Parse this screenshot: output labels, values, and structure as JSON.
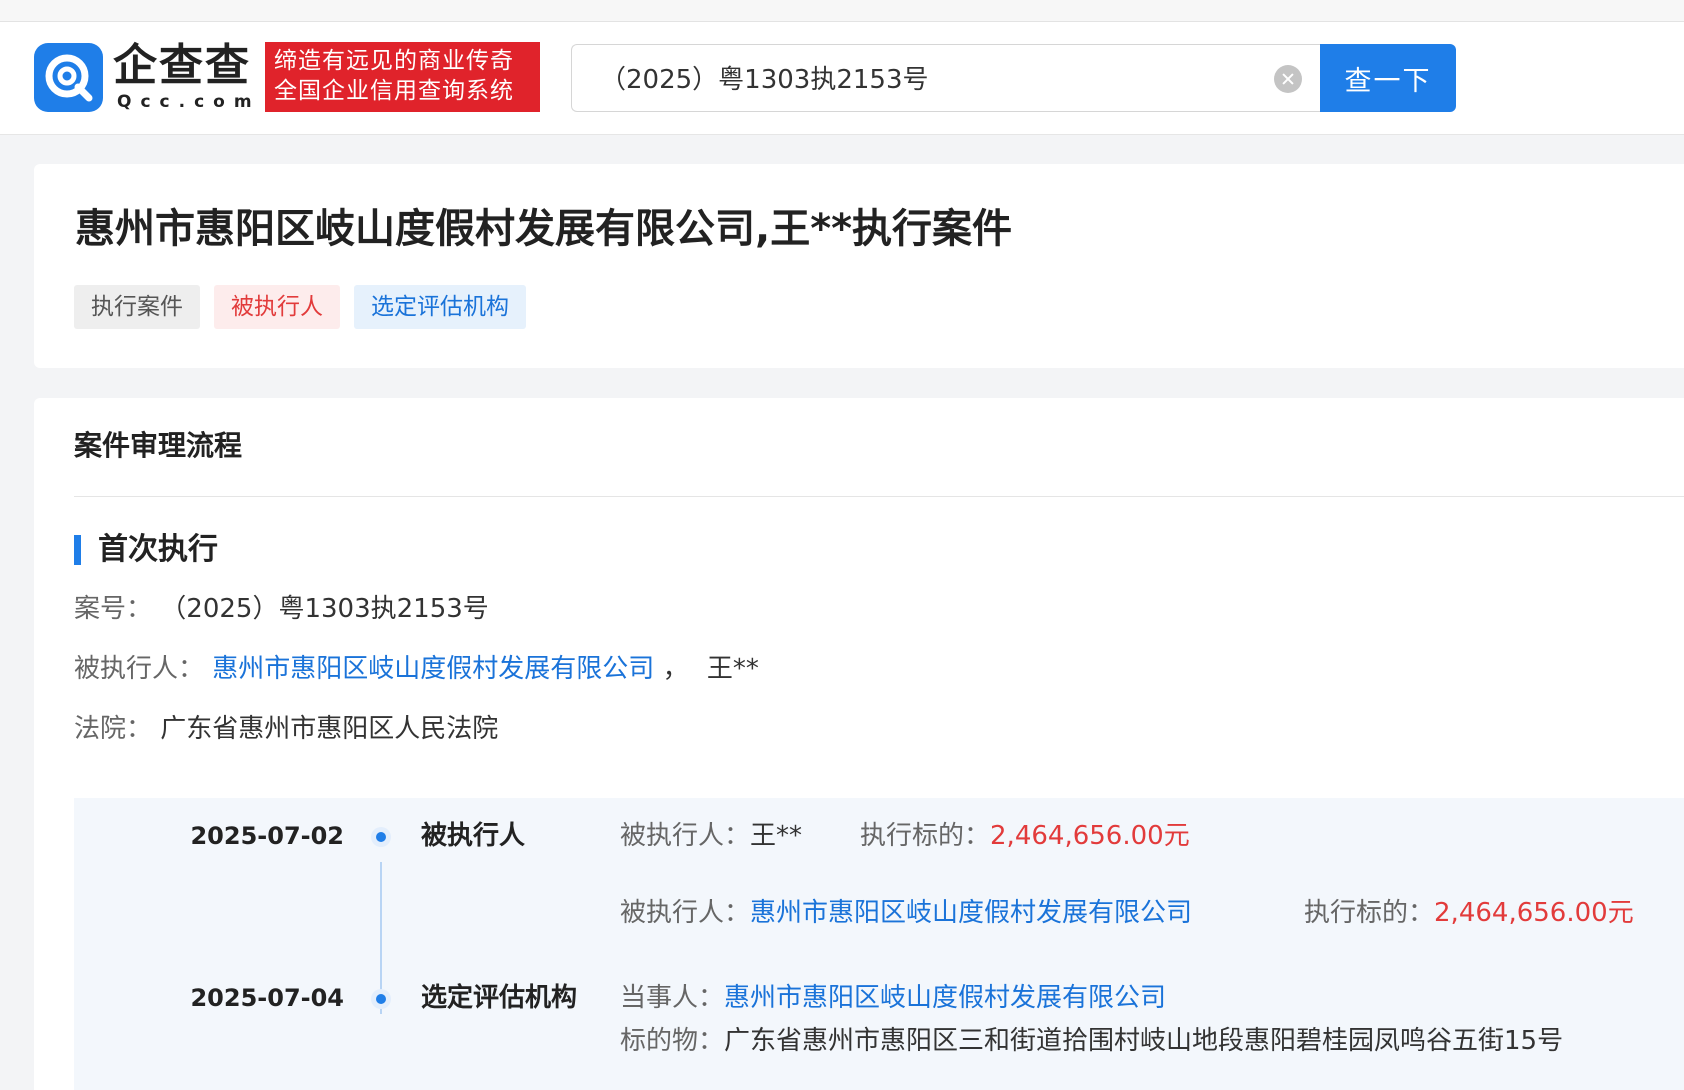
{
  "logo": {
    "name_cn": "企查查",
    "domain": "Qcc.com",
    "slogan_line1": "缔造有远见的商业传奇",
    "slogan_line2": "全国企业信用查询系统"
  },
  "search": {
    "query": "（2025）粤1303执2153号",
    "button_label": "查一下"
  },
  "case": {
    "title": "惠州市惠阳区岐山度假村发展有限公司,王**执行案件",
    "tags": [
      "执行案件",
      "被执行人",
      "选定评估机构"
    ]
  },
  "process": {
    "section_title": "案件审理流程",
    "stage_title": "首次执行",
    "case_no_label": "案号：",
    "case_no": "（2025）粤1303执2153号",
    "executed_label": "被执行人：",
    "executed_company": "惠州市惠阳区岐山度假村发展有限公司",
    "executed_sep": "，",
    "executed_person": "王**",
    "court_label": "法院：",
    "court": "广东省惠州市惠阳区人民法院"
  },
  "timeline": [
    {
      "date": "2025-07-02",
      "type": "被执行人",
      "entries": [
        {
          "label": "被执行人：",
          "party": "王**",
          "amount_label": "执行标的：",
          "amount": "2,464,656.00元"
        },
        {
          "label": "被执行人：",
          "party": "惠州市惠阳区岐山度假村发展有限公司",
          "amount_label": "执行标的：",
          "amount": "2,464,656.00元"
        }
      ]
    },
    {
      "date": "2025-07-04",
      "type": "选定评估机构",
      "party_label": "当事人：",
      "party": "惠州市惠阳区岐山度假村发展有限公司",
      "object_label": "标的物：",
      "object": "广东省惠州市惠阳区三和街道拾围村岐山地段惠阳碧桂园凤鸣谷五街15号"
    }
  ],
  "colors": {
    "brand_blue": "#1f7ee8",
    "slogan_red": "#e0232b",
    "amount_red": "#e23b3b",
    "link_blue": "#1a73d9"
  },
  "icons": {
    "logo": "qcc-logo-icon",
    "clear": "clear-icon"
  }
}
